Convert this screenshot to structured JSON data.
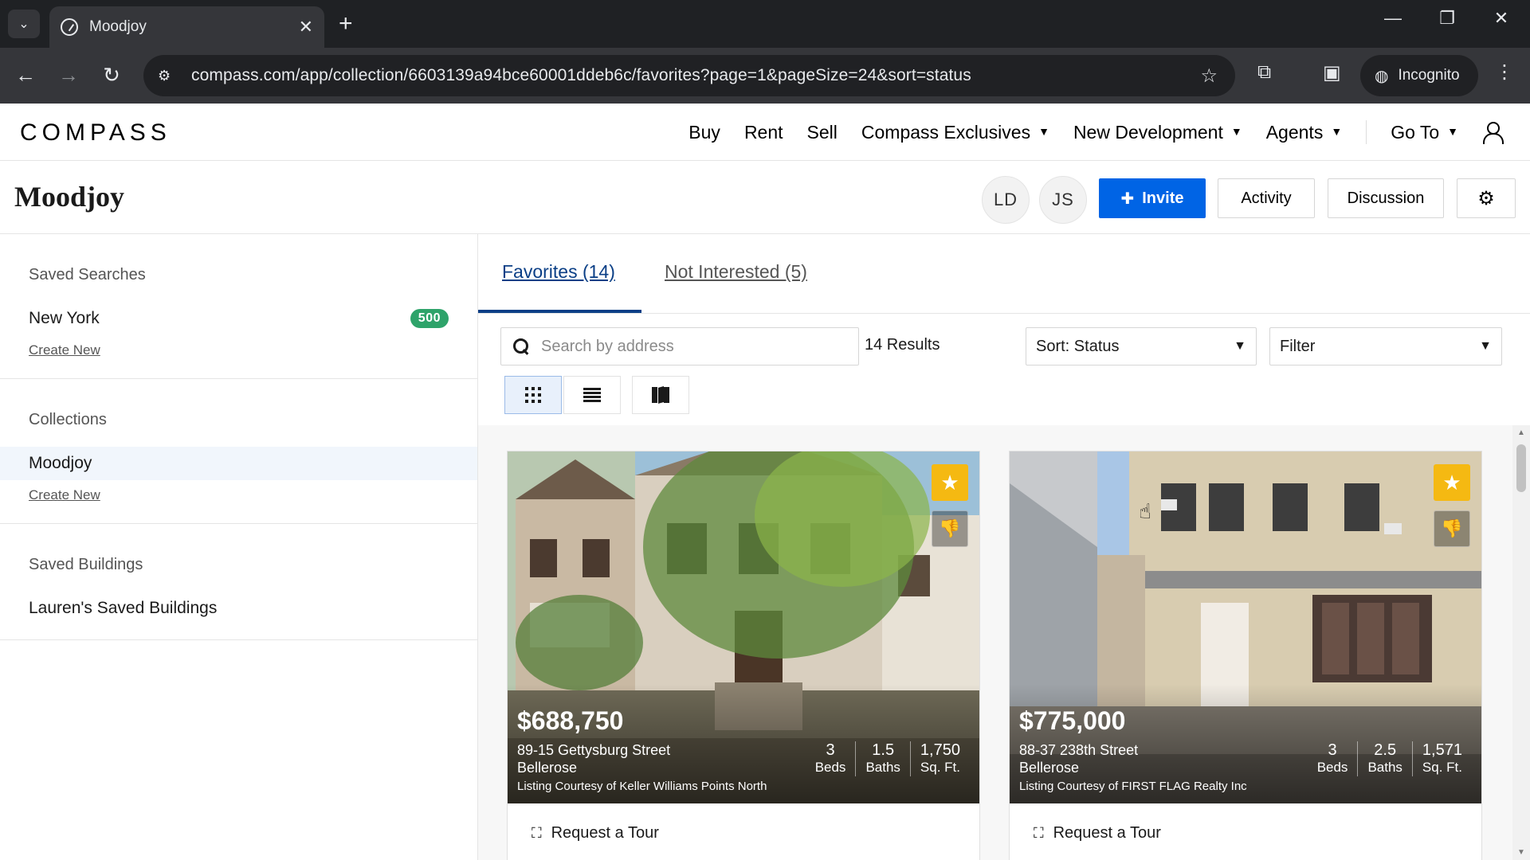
{
  "browser": {
    "tab_title": "Moodjoy",
    "url": "compass.com/app/collection/6603139a94bce60001ddeb6c/favorites?page=1&pageSize=24&sort=status",
    "incognito_label": "Incognito"
  },
  "site": {
    "logo": "COMPASS",
    "nav": {
      "buy": "Buy",
      "rent": "Rent",
      "sell": "Sell",
      "exclusives": "Compass Exclusives",
      "new_dev": "New Development",
      "agents": "Agents",
      "goto": "Go To"
    }
  },
  "collection": {
    "title": "Moodjoy",
    "members": [
      "LD",
      "JS"
    ],
    "invite_label": "Invite",
    "activity_label": "Activity",
    "discussion_label": "Discussion"
  },
  "sidebar": {
    "saved_searches": {
      "heading": "Saved Searches",
      "items": [
        {
          "label": "New York",
          "count": "500"
        }
      ],
      "create_label": "Create New"
    },
    "collections": {
      "heading": "Collections",
      "items": [
        {
          "label": "Moodjoy"
        }
      ],
      "create_label": "Create New"
    },
    "saved_buildings": {
      "heading": "Saved Buildings",
      "items": [
        {
          "label": "Lauren's Saved Buildings"
        }
      ]
    }
  },
  "main": {
    "tabs": [
      {
        "label": "Favorites (14)",
        "active": true
      },
      {
        "label": "Not Interested (5)",
        "active": false
      }
    ],
    "search": {
      "placeholder": "Search by address",
      "value": ""
    },
    "results_label": "14 Results",
    "sort_label": "Sort: Status",
    "filter_label": "Filter"
  },
  "listings": [
    {
      "price": "$688,750",
      "street": "89-15 Gettysburg Street",
      "city": "Bellerose",
      "courtesy": "Listing Courtesy of Keller Williams Points North",
      "beds": "3",
      "beds_label": "Beds",
      "baths": "1.5",
      "baths_label": "Baths",
      "sqft": "1,750",
      "sqft_label": "Sq. Ft.",
      "tour_label": "Request a Tour"
    },
    {
      "price": "$775,000",
      "street": "88-37 238th Street",
      "city": "Bellerose",
      "courtesy": "Listing Courtesy of FIRST FLAG Realty Inc",
      "beds": "3",
      "beds_label": "Beds",
      "baths": "2.5",
      "baths_label": "Baths",
      "sqft": "1,571",
      "sqft_label": "Sq. Ft.",
      "tour_label": "Request a Tour"
    }
  ],
  "colors": {
    "primary": "#0064e5",
    "favorite": "#f5b912",
    "badge": "#2ea36a",
    "tab_active": "#0b3f86"
  }
}
